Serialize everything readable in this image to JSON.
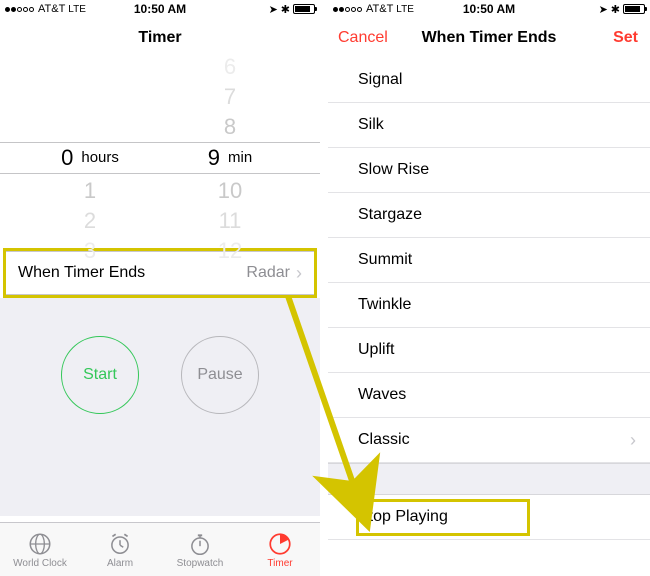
{
  "status": {
    "carrier": "AT&T",
    "network": "LTE",
    "time": "10:50 AM"
  },
  "left": {
    "title": "Timer",
    "picker": {
      "hours_above": [
        "",
        "",
        ""
      ],
      "hours_selected": "0",
      "hours_unit": "hours",
      "hours_below": [
        "1",
        "2",
        "3"
      ],
      "mins_above": [
        "6",
        "7",
        "8"
      ],
      "mins_selected": "9",
      "mins_unit": "min",
      "mins_below": [
        "10",
        "11",
        "12"
      ]
    },
    "when_ends": {
      "label": "When Timer Ends",
      "value": "Radar"
    },
    "start": "Start",
    "pause": "Pause",
    "tabs": {
      "world": "World Clock",
      "alarm": "Alarm",
      "stopwatch": "Stopwatch",
      "timer": "Timer"
    }
  },
  "right": {
    "cancel": "Cancel",
    "title": "When Timer Ends",
    "set": "Set",
    "sounds": [
      "Signal",
      "Silk",
      "Slow Rise",
      "Stargaze",
      "Summit",
      "Twinkle",
      "Uplift",
      "Waves"
    ],
    "classic": "Classic",
    "stop": "Stop Playing"
  }
}
